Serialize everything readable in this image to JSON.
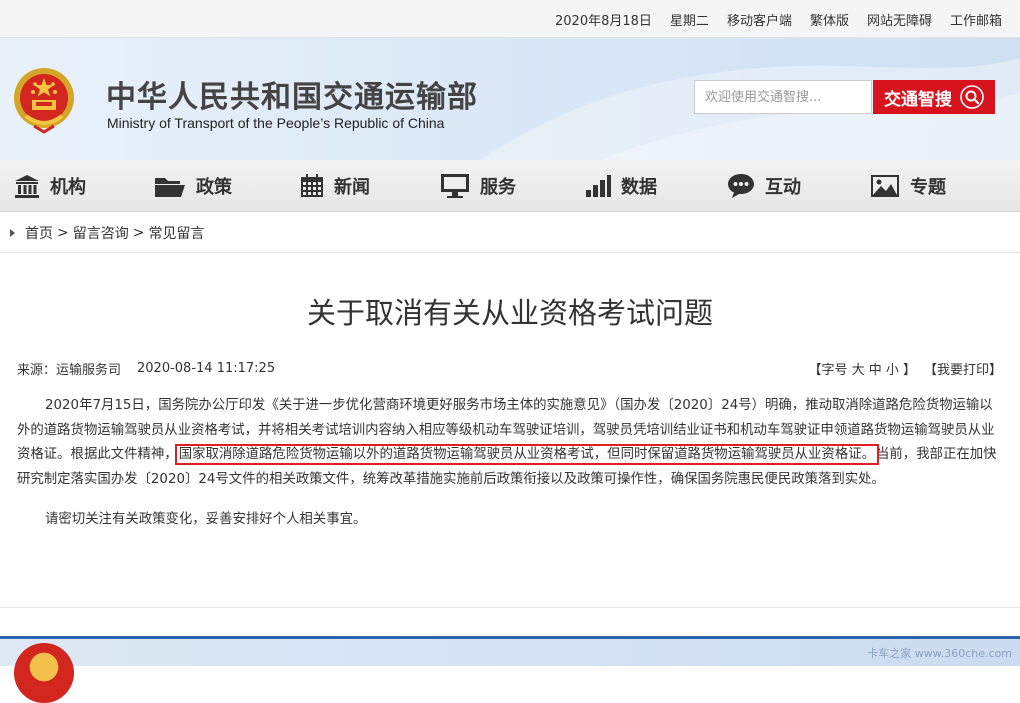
{
  "topbar": {
    "date": "2020年8月18日",
    "weekday": "星期二",
    "mobile": "移动客户端",
    "traditional": "繁体版",
    "accessible": "网站无障碍",
    "email": "工作邮箱"
  },
  "header": {
    "title_cn": "中华人民共和国交通运输部",
    "title_en": "Ministry of Transport of the People’s Republic of China",
    "search_placeholder": "欢迎使用交通智搜...",
    "search_button": "交通智搜"
  },
  "nav": {
    "items": [
      {
        "label": "机构",
        "icon": "building-icon"
      },
      {
        "label": "政策",
        "icon": "folder-icon"
      },
      {
        "label": "新闻",
        "icon": "calendar-icon"
      },
      {
        "label": "服务",
        "icon": "monitor-icon"
      },
      {
        "label": "数据",
        "icon": "bar-chart-icon"
      },
      {
        "label": "互动",
        "icon": "chat-icon"
      },
      {
        "label": "专题",
        "icon": "image-icon"
      }
    ]
  },
  "breadcrumb": {
    "home": "首页",
    "sep1": ">",
    "section": "留言咨询",
    "sep2": ">",
    "current": "常见留言"
  },
  "article": {
    "title": "关于取消有关从业资格考试问题",
    "source": "来源：运输服务司",
    "datetime": "2020-08-14 11:17:25",
    "font_size_label": "【字号 大 中 小 】",
    "print_label": "【我要打印】",
    "p1_a": "2020年7月15日，国务院办公厅印发《关于进一步优化营商环境更好服务市场主体的实施意见》（国办发〔2020〕24号）明确，推动取消除道路危险货物运输以外的道路货物运输驾驶员从业资格考试，并将相关考试培训内容纳入相应等级机动车驾驶证培训，驾驶员凭培训结业证书和机动车驾驶证申领道路货物运输驾驶员从业资格证。根据此文件精神，",
    "p1_highlight": "国家取消除道路危险货物运输以外的道路货物运输驾驶员从业资格考试，但同时保留道路货物运输驾驶员从业资格证。",
    "p1_b": "当前，我部正在加快研究制定落实国办发〔2020〕24号文件的相关政策文件，统筹改革措施实施前后政策衔接以及政策可操作性，确保国务院惠民便民政策落到实处。",
    "p2": "请密切关注有关政策变化，妥善安排好个人相关事宜。"
  },
  "watermark": "卡车之家 www.360che.com",
  "colors": {
    "accent_red": "#d7141d",
    "footer_blue": "#2b63b0",
    "highlight_box": "#e02020"
  }
}
